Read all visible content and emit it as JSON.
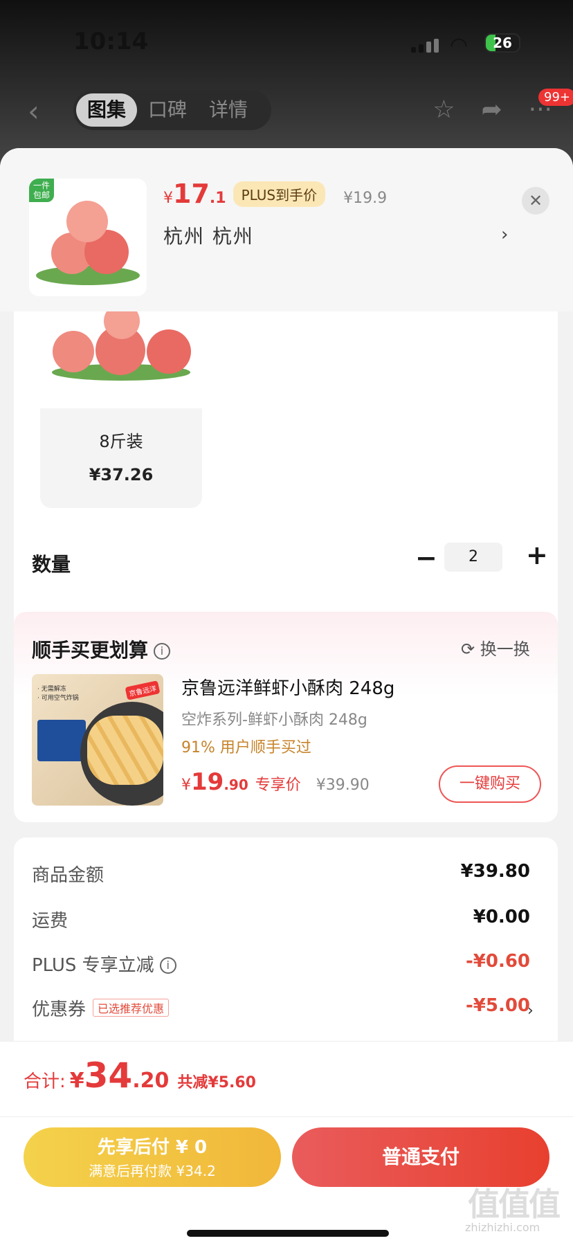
{
  "status": {
    "time": "10:14",
    "battery": "26"
  },
  "nav": {
    "tabs": [
      "图集",
      "口碑",
      "详情"
    ],
    "active_tab": 0,
    "badge": "99+"
  },
  "product": {
    "thumb_tag": "一件\n包邮",
    "price_currency": "¥",
    "price_int": "17",
    "price_dec": ".1",
    "plus_tag": "PLUS到手价",
    "original_price": "¥19.9",
    "address": "杭州  杭州"
  },
  "spec": {
    "name": "8斤装",
    "price": "¥37.26"
  },
  "quantity": {
    "label": "数量",
    "value": "2"
  },
  "addon": {
    "title": "顺手买更划算",
    "swap_label": "换一换",
    "name": "京鲁远洋鲜虾小酥肉 248g",
    "subtitle": "空炸系列-鲜虾小酥肉 248g",
    "percent_text": "91% 用户顺手买过",
    "price_currency": "¥",
    "price_int": "19",
    "price_dec": ".90",
    "price_label": "专享价",
    "original_price": "¥39.90",
    "buy_label": "一键购买",
    "img_note": "· 无需解冻\n· 可用空气炸锅",
    "img_logo": "京鲁远洋"
  },
  "summary": {
    "rows": [
      {
        "label": "商品金额",
        "value": "¥39.80"
      },
      {
        "label": "运费",
        "value": "¥0.00"
      },
      {
        "label": "PLUS 专享立减",
        "value": "-¥0.60"
      },
      {
        "label": "优惠券",
        "value": "-¥5.00",
        "tag": "已选推荐优惠"
      }
    ]
  },
  "total": {
    "label": "合计:",
    "currency": "¥",
    "int": "34",
    "dec": ".20",
    "saved": "共减¥5.60"
  },
  "actions": {
    "later_line1": "先享后付 ¥ 0",
    "later_line2": "满意后再付款 ¥34.2",
    "pay_label": "普通支付"
  },
  "watermark": {
    "text": "值值值",
    "sub": "zhizhizhi.com"
  },
  "colors": {
    "accent": "#e43a3a",
    "plus_tag_bg": "#fbe7b6",
    "later_btn": "#f1c53f",
    "pay_btn": "#e8452f"
  }
}
